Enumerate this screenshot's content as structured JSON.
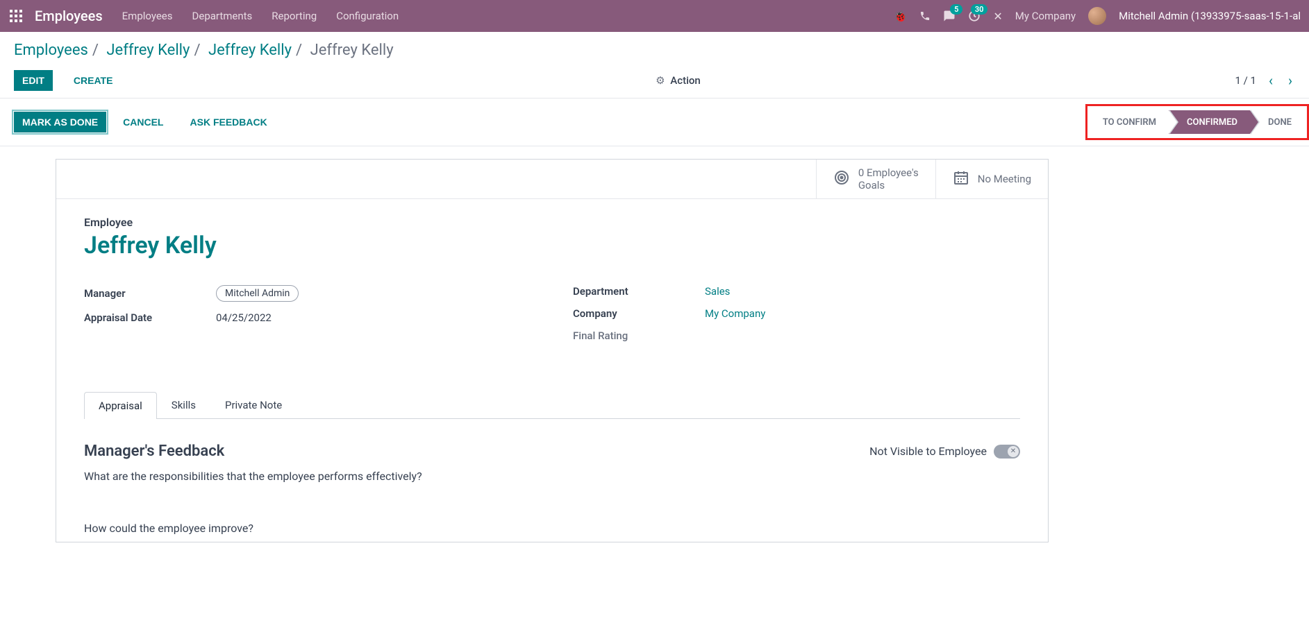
{
  "navbar": {
    "brand": "Employees",
    "menu": [
      "Employees",
      "Departments",
      "Reporting",
      "Configuration"
    ],
    "chat_badge": "5",
    "clock_badge": "30",
    "company": "My Company",
    "user": "Mitchell Admin (13933975-saas-15-1-al"
  },
  "breadcrumb": {
    "items": [
      "Employees",
      "Jeffrey Kelly",
      "Jeffrey Kelly"
    ],
    "current": "Jeffrey Kelly"
  },
  "actions": {
    "edit": "EDIT",
    "create": "CREATE",
    "action": "Action",
    "pager": "1 / 1"
  },
  "statusbar": {
    "mark_done": "MARK AS DONE",
    "cancel": "CANCEL",
    "ask_feedback": "ASK FEEDBACK",
    "steps": [
      "TO CONFIRM",
      "CONFIRMED",
      "DONE"
    ],
    "active_index": 1
  },
  "stat_btns": {
    "goals_line1": "0 Employee's",
    "goals_line2": "Goals",
    "meeting": "No Meeting"
  },
  "form": {
    "employee_label": "Employee",
    "employee_name": "Jeffrey Kelly",
    "manager_label": "Manager",
    "manager_value": "Mitchell Admin",
    "date_label": "Appraisal Date",
    "date_value": "04/25/2022",
    "dept_label": "Department",
    "dept_value": "Sales",
    "company_label": "Company",
    "company_value": "My Company",
    "rating_label": "Final Rating"
  },
  "tabs": [
    "Appraisal",
    "Skills",
    "Private Note"
  ],
  "feedback": {
    "heading": "Manager's Feedback",
    "visibility": "Not Visible to Employee",
    "q1": "What are the responsibilities that the employee performs effectively?",
    "q2": "How could the employee improve?"
  }
}
